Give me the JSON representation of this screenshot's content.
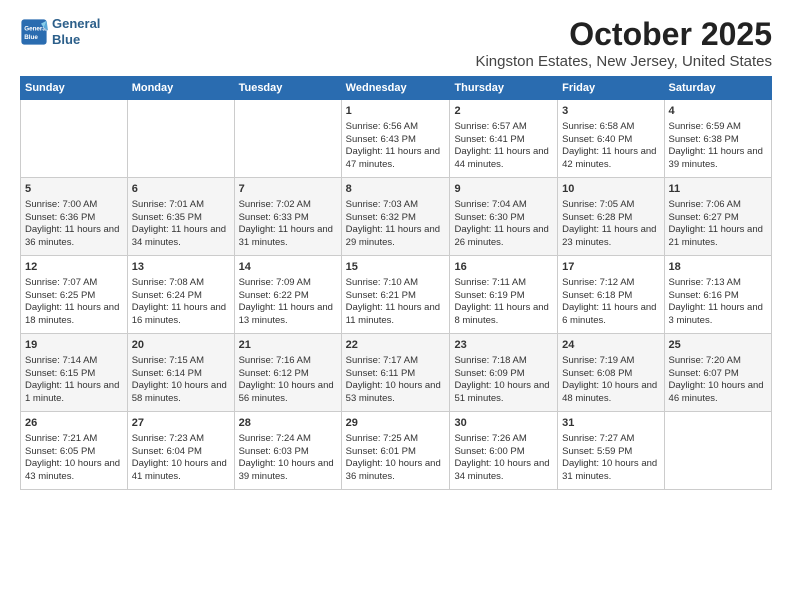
{
  "header": {
    "logo_line1": "General",
    "logo_line2": "Blue",
    "title": "October 2025",
    "subtitle": "Kingston Estates, New Jersey, United States"
  },
  "days_of_week": [
    "Sunday",
    "Monday",
    "Tuesday",
    "Wednesday",
    "Thursday",
    "Friday",
    "Saturday"
  ],
  "weeks": [
    {
      "cells": [
        {
          "day": null,
          "content": ""
        },
        {
          "day": null,
          "content": ""
        },
        {
          "day": null,
          "content": ""
        },
        {
          "day": 1,
          "content": "Sunrise: 6:56 AM\nSunset: 6:43 PM\nDaylight: 11 hours and 47 minutes."
        },
        {
          "day": 2,
          "content": "Sunrise: 6:57 AM\nSunset: 6:41 PM\nDaylight: 11 hours and 44 minutes."
        },
        {
          "day": 3,
          "content": "Sunrise: 6:58 AM\nSunset: 6:40 PM\nDaylight: 11 hours and 42 minutes."
        },
        {
          "day": 4,
          "content": "Sunrise: 6:59 AM\nSunset: 6:38 PM\nDaylight: 11 hours and 39 minutes."
        }
      ]
    },
    {
      "cells": [
        {
          "day": 5,
          "content": "Sunrise: 7:00 AM\nSunset: 6:36 PM\nDaylight: 11 hours and 36 minutes."
        },
        {
          "day": 6,
          "content": "Sunrise: 7:01 AM\nSunset: 6:35 PM\nDaylight: 11 hours and 34 minutes."
        },
        {
          "day": 7,
          "content": "Sunrise: 7:02 AM\nSunset: 6:33 PM\nDaylight: 11 hours and 31 minutes."
        },
        {
          "day": 8,
          "content": "Sunrise: 7:03 AM\nSunset: 6:32 PM\nDaylight: 11 hours and 29 minutes."
        },
        {
          "day": 9,
          "content": "Sunrise: 7:04 AM\nSunset: 6:30 PM\nDaylight: 11 hours and 26 minutes."
        },
        {
          "day": 10,
          "content": "Sunrise: 7:05 AM\nSunset: 6:28 PM\nDaylight: 11 hours and 23 minutes."
        },
        {
          "day": 11,
          "content": "Sunrise: 7:06 AM\nSunset: 6:27 PM\nDaylight: 11 hours and 21 minutes."
        }
      ]
    },
    {
      "cells": [
        {
          "day": 12,
          "content": "Sunrise: 7:07 AM\nSunset: 6:25 PM\nDaylight: 11 hours and 18 minutes."
        },
        {
          "day": 13,
          "content": "Sunrise: 7:08 AM\nSunset: 6:24 PM\nDaylight: 11 hours and 16 minutes."
        },
        {
          "day": 14,
          "content": "Sunrise: 7:09 AM\nSunset: 6:22 PM\nDaylight: 11 hours and 13 minutes."
        },
        {
          "day": 15,
          "content": "Sunrise: 7:10 AM\nSunset: 6:21 PM\nDaylight: 11 hours and 11 minutes."
        },
        {
          "day": 16,
          "content": "Sunrise: 7:11 AM\nSunset: 6:19 PM\nDaylight: 11 hours and 8 minutes."
        },
        {
          "day": 17,
          "content": "Sunrise: 7:12 AM\nSunset: 6:18 PM\nDaylight: 11 hours and 6 minutes."
        },
        {
          "day": 18,
          "content": "Sunrise: 7:13 AM\nSunset: 6:16 PM\nDaylight: 11 hours and 3 minutes."
        }
      ]
    },
    {
      "cells": [
        {
          "day": 19,
          "content": "Sunrise: 7:14 AM\nSunset: 6:15 PM\nDaylight: 11 hours and 1 minute."
        },
        {
          "day": 20,
          "content": "Sunrise: 7:15 AM\nSunset: 6:14 PM\nDaylight: 10 hours and 58 minutes."
        },
        {
          "day": 21,
          "content": "Sunrise: 7:16 AM\nSunset: 6:12 PM\nDaylight: 10 hours and 56 minutes."
        },
        {
          "day": 22,
          "content": "Sunrise: 7:17 AM\nSunset: 6:11 PM\nDaylight: 10 hours and 53 minutes."
        },
        {
          "day": 23,
          "content": "Sunrise: 7:18 AM\nSunset: 6:09 PM\nDaylight: 10 hours and 51 minutes."
        },
        {
          "day": 24,
          "content": "Sunrise: 7:19 AM\nSunset: 6:08 PM\nDaylight: 10 hours and 48 minutes."
        },
        {
          "day": 25,
          "content": "Sunrise: 7:20 AM\nSunset: 6:07 PM\nDaylight: 10 hours and 46 minutes."
        }
      ]
    },
    {
      "cells": [
        {
          "day": 26,
          "content": "Sunrise: 7:21 AM\nSunset: 6:05 PM\nDaylight: 10 hours and 43 minutes."
        },
        {
          "day": 27,
          "content": "Sunrise: 7:23 AM\nSunset: 6:04 PM\nDaylight: 10 hours and 41 minutes."
        },
        {
          "day": 28,
          "content": "Sunrise: 7:24 AM\nSunset: 6:03 PM\nDaylight: 10 hours and 39 minutes."
        },
        {
          "day": 29,
          "content": "Sunrise: 7:25 AM\nSunset: 6:01 PM\nDaylight: 10 hours and 36 minutes."
        },
        {
          "day": 30,
          "content": "Sunrise: 7:26 AM\nSunset: 6:00 PM\nDaylight: 10 hours and 34 minutes."
        },
        {
          "day": 31,
          "content": "Sunrise: 7:27 AM\nSunset: 5:59 PM\nDaylight: 10 hours and 31 minutes."
        },
        {
          "day": null,
          "content": ""
        }
      ]
    }
  ]
}
